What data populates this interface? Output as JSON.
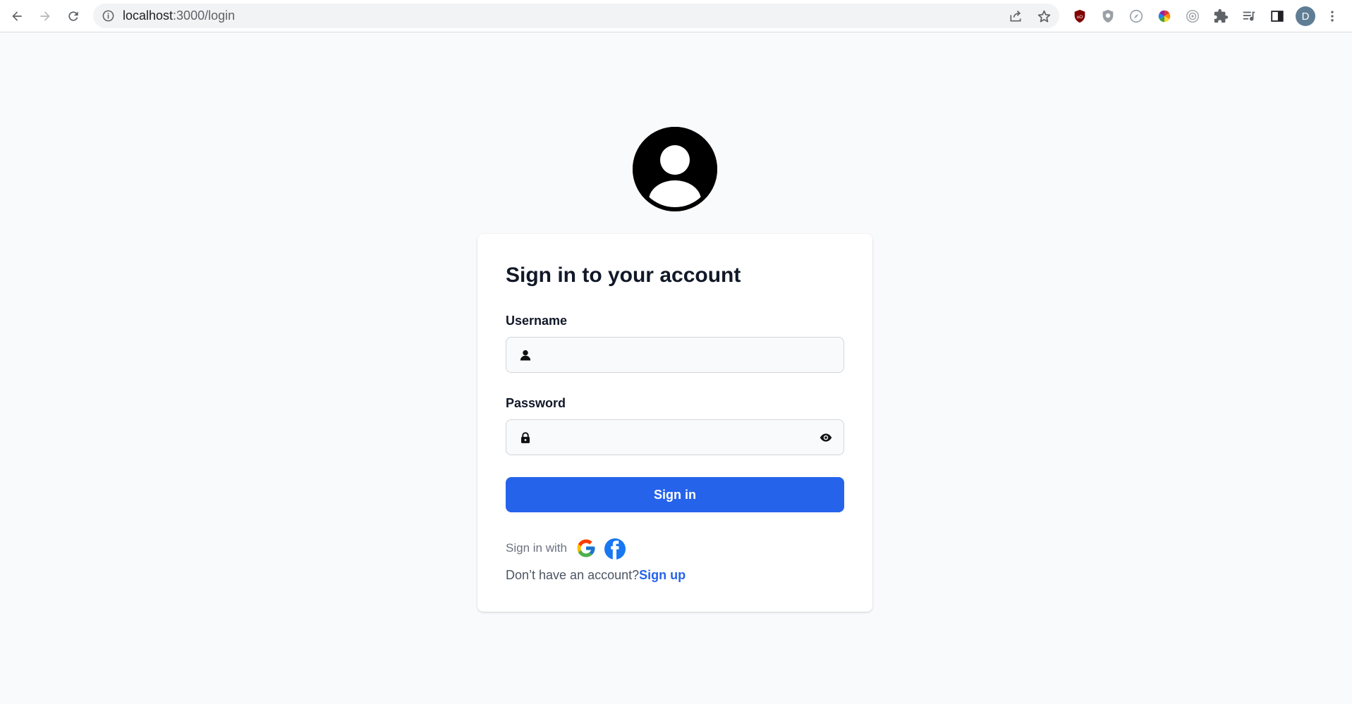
{
  "browser": {
    "url_host": "localhost",
    "url_rest": ":3000/login",
    "profile_initial": "D",
    "icons": [
      "back-icon",
      "forward-icon",
      "reload-icon",
      "site-info-icon",
      "share-icon",
      "bookmark-star-icon",
      "ublock-icon",
      "shield-extension-icon",
      "compass-extension-icon",
      "color-wheel-extension-icon",
      "camera-extension-icon",
      "extensions-puzzle-icon",
      "media-queue-icon",
      "side-panel-icon",
      "more-menu-icon"
    ]
  },
  "login": {
    "title": "Sign in to your account",
    "username_label": "Username",
    "username_value": "",
    "password_label": "Password",
    "password_value": "",
    "submit_label": "Sign in",
    "social_text": "Sign in with",
    "no_account_text": "Don’t have an account?",
    "signup_link": "Sign up"
  },
  "colors": {
    "accent": "#2563eb",
    "background": "#f9fafb",
    "card": "#ffffff",
    "facebook": "#1877f2"
  }
}
